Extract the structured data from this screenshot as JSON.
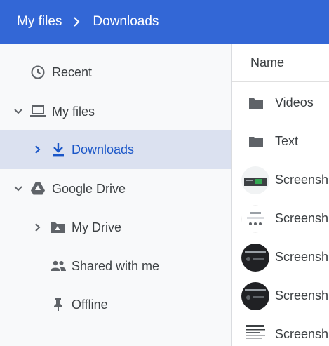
{
  "breadcrumb": {
    "root": "My files",
    "current": "Downloads"
  },
  "sidebar": {
    "items": [
      {
        "label": "Recent",
        "icon": "clock-icon"
      },
      {
        "label": "My files",
        "icon": "laptop-icon"
      },
      {
        "label": "Downloads",
        "icon": "download-icon",
        "selected": true
      },
      {
        "label": "Google Drive",
        "icon": "drive-icon"
      },
      {
        "label": "My Drive",
        "icon": "drive-folder-icon"
      },
      {
        "label": "Shared with me",
        "icon": "people-icon"
      },
      {
        "label": "Offline",
        "icon": "pin-icon"
      }
    ]
  },
  "filelist": {
    "column_name": "Name",
    "rows": [
      {
        "name": "Videos",
        "kind": "folder"
      },
      {
        "name": "Text",
        "kind": "folder"
      },
      {
        "name": "Screensh",
        "kind": "image"
      },
      {
        "name": "Screensh",
        "kind": "image"
      },
      {
        "name": "Screensh",
        "kind": "image"
      },
      {
        "name": "Screensh",
        "kind": "image"
      },
      {
        "name": "Screensh",
        "kind": "image"
      }
    ]
  },
  "colors": {
    "header": "#3367d6",
    "selected_bg": "#dbe1f0",
    "selected_text": "#1a56c8",
    "sidebar_bg": "#f8f9fa"
  }
}
